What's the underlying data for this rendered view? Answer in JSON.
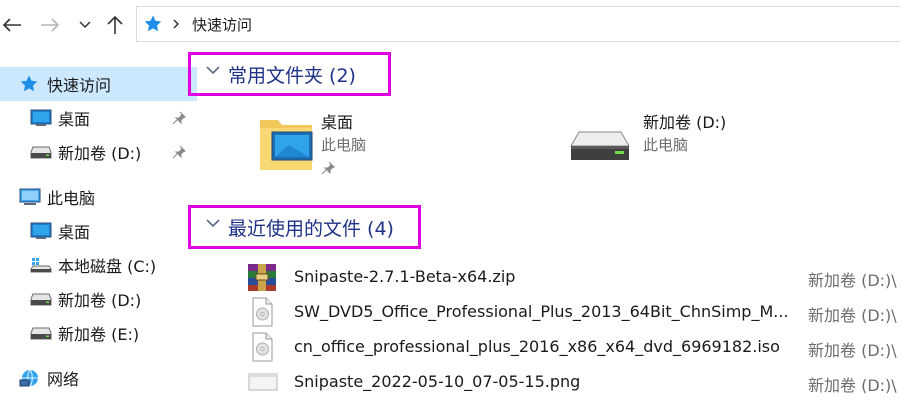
{
  "address_bar": {
    "path": "快速访问"
  },
  "nav_pane": {
    "items": [
      {
        "label": "快速访问",
        "icon": "star-icon",
        "selected": true,
        "pinned": false
      },
      {
        "label": "桌面",
        "icon": "desktop-icon",
        "selected": false,
        "pinned": true
      },
      {
        "label": "新加卷 (D:)",
        "icon": "drive-icon",
        "selected": false,
        "pinned": true
      },
      {
        "label": "此电脑",
        "icon": "computer-icon",
        "selected": false,
        "pinned": false
      },
      {
        "label": "桌面",
        "icon": "desktop-icon",
        "selected": false,
        "pinned": false
      },
      {
        "label": "本地磁盘 (C:)",
        "icon": "system-drive-icon",
        "selected": false,
        "pinned": false
      },
      {
        "label": "新加卷 (D:)",
        "icon": "drive-icon",
        "selected": false,
        "pinned": false
      },
      {
        "label": "新加卷 (E:)",
        "icon": "drive-icon",
        "selected": false,
        "pinned": false
      },
      {
        "label": "网络",
        "icon": "network-icon",
        "selected": false,
        "pinned": false
      }
    ]
  },
  "frequent_folders": {
    "title": "常用文件夹 (2)",
    "items": [
      {
        "name": "桌面",
        "location": "此电脑",
        "icon": "desktop-folder-icon",
        "pinned": true
      },
      {
        "name": "新加卷 (D:)",
        "location": "此电脑",
        "icon": "hard-drive-icon",
        "pinned": false
      }
    ]
  },
  "recent_files": {
    "title": "最近使用的文件 (4)",
    "items": [
      {
        "name": "Snipaste-2.7.1-Beta-x64.zip",
        "location": "新加卷 (D:)\\",
        "icon": "winrar-archive-icon"
      },
      {
        "name": "SW_DVD5_Office_Professional_Plus_2013_64Bit_ChnSimp_M...",
        "location": "新加卷 (D:)\\",
        "icon": "disc-image-icon"
      },
      {
        "name": "cn_office_professional_plus_2016_x86_x64_dvd_6969182.iso",
        "location": "新加卷 (D:)\\",
        "icon": "disc-image-icon"
      },
      {
        "name": "Snipaste_2022-05-10_07-05-15.png",
        "location": "新加卷 (D:)\\",
        "icon": "image-file-icon"
      }
    ]
  },
  "colors": {
    "selection": "#cce8ff",
    "group_header_text": "#1e3287",
    "highlight_box": "#e100e1",
    "secondary_text": "#6d6d6d"
  }
}
